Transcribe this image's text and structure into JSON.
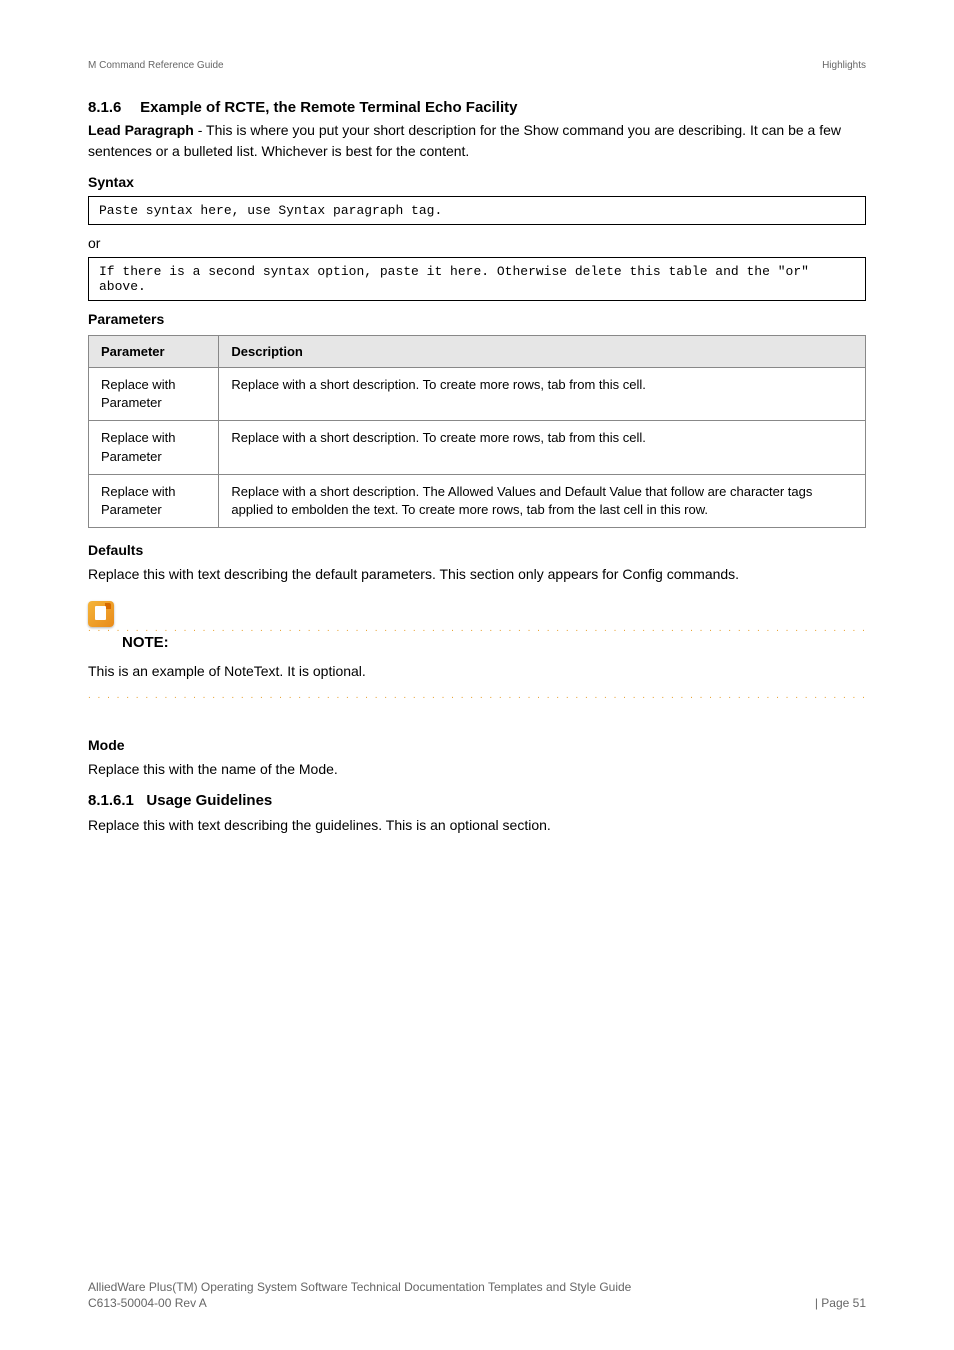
{
  "header": {
    "left": "M Command Reference Guide",
    "right": "Highlights"
  },
  "section816": {
    "number": "8.1.6",
    "title": "Example of RCTE, the Remote Terminal Echo Facility",
    "body": "Lead Paragraph - This is where you put your short description for the Show command you are describing. It can be a few sentences or a bulleted list. Whichever is best for the content."
  },
  "syntax": {
    "heading": "Syntax",
    "line1": "Paste syntax here, use Syntax paragraph tag.",
    "separator": "or",
    "line2": "If there is a second syntax option, paste it here. Otherwise delete this table and the \"or\" above."
  },
  "params": {
    "heading": "Parameters",
    "table": {
      "th1": "Parameter",
      "th2": "Description",
      "rows": [
        {
          "p": "Replace with Parameter",
          "d": "Replace with a short description. To create more rows, tab from this cell."
        },
        {
          "p": "Replace with Parameter",
          "d": "Replace with a short description. To create more rows, tab from this cell."
        },
        {
          "p": "Replace with Parameter",
          "d": "Replace with a short description. The Allowed Values and Default Value that follow are character tags applied to embolden the text. To create more rows, tab from the last cell in this row."
        }
      ]
    }
  },
  "defaults": {
    "heading": "Defaults",
    "body": "Replace this with text describing the default parameters. This section only appears for Config commands."
  },
  "note": {
    "label": "NOTE:",
    "body": "This is an example of NoteText. It is optional."
  },
  "mode": {
    "heading": "Mode",
    "body": "Replace this with the name of the Mode."
  },
  "section8161": {
    "number": "8.1.6.1",
    "title": "Usage Guidelines",
    "body": "Replace this with text describing the guidelines. This is an optional section."
  },
  "footer": {
    "product": "AlliedWare Plus(TM) Operating System Software Technical Documentation Templates and Style Guide",
    "docnum": "C613-50004-00 Rev A",
    "page": "| Page 51"
  }
}
